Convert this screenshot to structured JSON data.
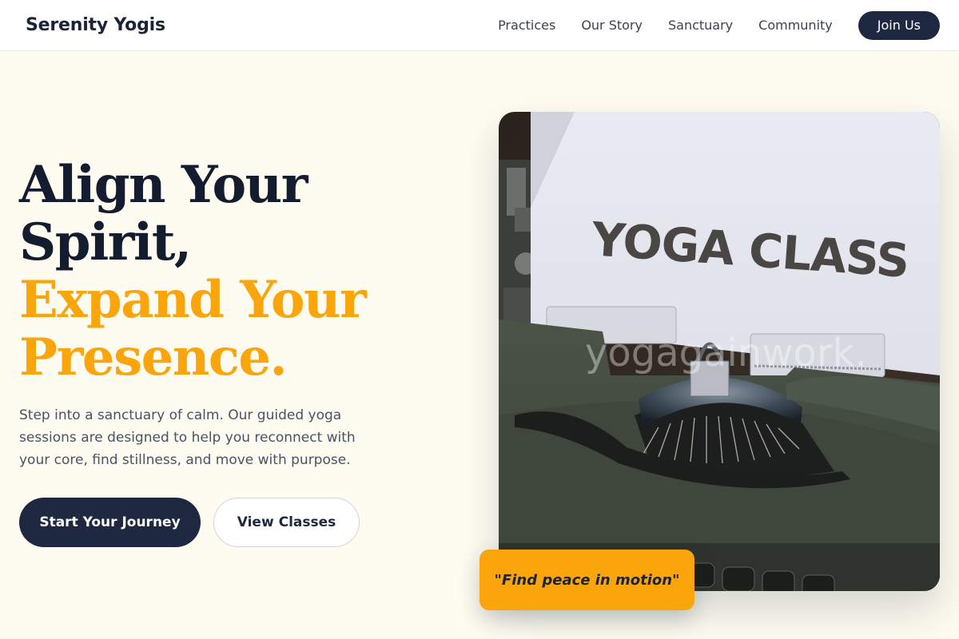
{
  "brand": {
    "name": "Serenity Yogis"
  },
  "nav": {
    "items": [
      {
        "label": "Practices"
      },
      {
        "label": "Our Story"
      },
      {
        "label": "Sanctuary"
      },
      {
        "label": "Community"
      }
    ],
    "cta": "Join Us"
  },
  "hero": {
    "headline_lines": [
      "Align Your",
      "Spirit,",
      "Expand Your",
      "Presence."
    ],
    "description": "Step into a sanctuary of calm. Our guided yoga sessions are designed to help you reconnect with your core, find stillness, and move with purpose.",
    "primary_button": "Start Your Journey",
    "secondary_button": "View Classes",
    "image": {
      "paper_text": "YOGA CLASS",
      "watermark": "yogagainwork."
    },
    "quote": "\"Find peace in motion\""
  },
  "colors": {
    "accent": "#f9a50b",
    "navy": "#1e2840",
    "background": "#fefcf0"
  }
}
